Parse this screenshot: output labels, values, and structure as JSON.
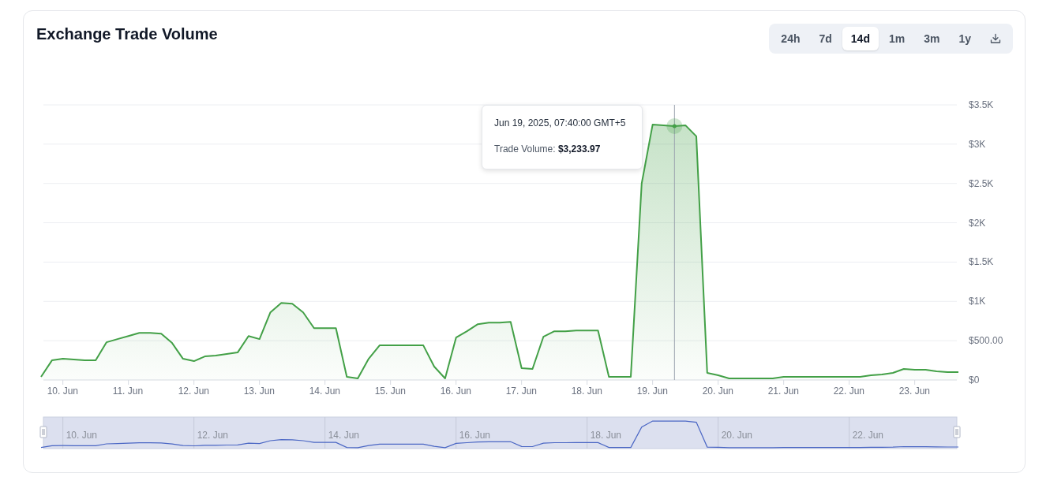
{
  "card": {
    "title": "Exchange Trade Volume",
    "ranges": [
      {
        "label": "24h",
        "selected": false
      },
      {
        "label": "7d",
        "selected": false
      },
      {
        "label": "14d",
        "selected": true
      },
      {
        "label": "1m",
        "selected": false
      },
      {
        "label": "3m",
        "selected": false
      },
      {
        "label": "1y",
        "selected": false
      }
    ],
    "chart": {
      "chart_data": {
        "type": "area",
        "grid": true,
        "ylim": [
          0,
          3500
        ],
        "categories": [
          null,
          null,
          "10. Jun",
          null,
          null,
          null,
          null,
          null,
          "11. Jun",
          null,
          null,
          null,
          null,
          null,
          "12. Jun",
          null,
          null,
          null,
          null,
          null,
          "13. Jun",
          null,
          null,
          null,
          null,
          null,
          "14. Jun",
          null,
          null,
          null,
          null,
          null,
          "15. Jun",
          null,
          null,
          null,
          null,
          null,
          "16. Jun",
          null,
          null,
          null,
          null,
          null,
          "17. Jun",
          null,
          null,
          null,
          null,
          null,
          "18. Jun",
          null,
          null,
          null,
          null,
          null,
          "19. Jun",
          null,
          null,
          null,
          null,
          null,
          "20. Jun",
          null,
          null,
          null,
          null,
          null,
          "21. Jun",
          null,
          null,
          null,
          null,
          null,
          "22. Jun",
          null,
          null,
          null,
          null,
          null,
          "23. Jun",
          null,
          null,
          null,
          null
        ],
        "yticks": [
          {
            "value": 0,
            "label": "$0"
          },
          {
            "value": 500,
            "label": "$500.00"
          },
          {
            "value": 1000,
            "label": "$1K"
          },
          {
            "value": 1500,
            "label": "$1.5K"
          },
          {
            "value": 2000,
            "label": "$2K"
          },
          {
            "value": 2500,
            "label": "$2.5K"
          },
          {
            "value": 3000,
            "label": "$3K"
          },
          {
            "value": 3500,
            "label": "$3.5K"
          }
        ],
        "series": [
          {
            "color": "#43a047",
            "values": [
              40,
              250,
              270,
              260,
              250,
              250,
              480,
              520,
              560,
              600,
              600,
              590,
              470,
              270,
              240,
              300,
              310,
              330,
              350,
              560,
              520,
              860,
              980,
              970,
              860,
              660,
              660,
              660,
              40,
              20,
              270,
              440,
              440,
              440,
              440,
              440,
              170,
              20,
              540,
              620,
              710,
              730,
              730,
              740,
              150,
              140,
              550,
              620,
              620,
              630,
              630,
              630,
              40,
              40,
              40,
              2500,
              3250,
              3240,
              3230,
              3240,
              3100,
              90,
              60,
              20,
              20,
              20,
              20,
              20,
              40,
              40,
              40,
              40,
              40,
              40,
              40,
              40,
              60,
              70,
              90,
              140,
              130,
              130,
              110,
              100,
              100
            ]
          }
        ]
      },
      "tooltip": {
        "date": "Jun 19, 2025, 07:40:00 GMT+5",
        "text": "Trade Volume: **$3,233.97**"
      }
    },
    "navigator": {
      "labels": [
        "10. Jun",
        "12. Jun",
        "14. Jun",
        "16. Jun",
        "18. Jun",
        "20. Jun",
        "22. Jun"
      ]
    }
  }
}
